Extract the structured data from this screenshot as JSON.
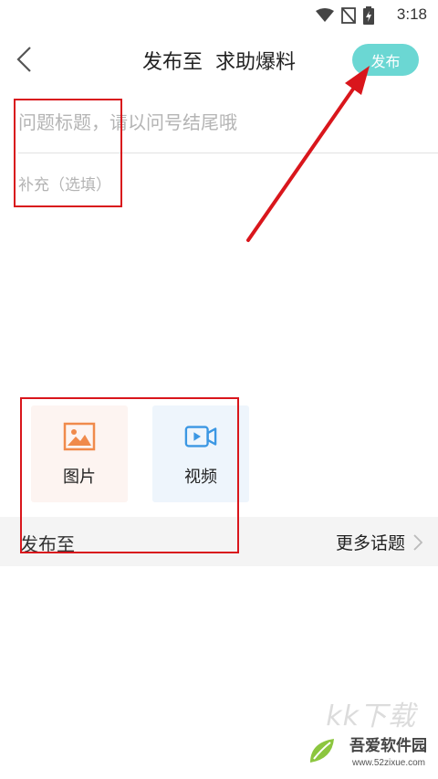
{
  "status_bar": {
    "time": "3:18"
  },
  "header": {
    "title": "发布至  求助爆料",
    "publish_label": "发布"
  },
  "form": {
    "title_placeholder": "问题标题，请以问号结尾哦",
    "supplement_placeholder": "补充（选填）"
  },
  "media": {
    "image_label": "图片",
    "video_label": "视频"
  },
  "publish_to": {
    "label": "发布至",
    "more_topics": "更多话题"
  },
  "watermark": {
    "logo": "kk下载",
    "site_name": "吾爱软件园",
    "url": "www.52zixue.com"
  },
  "colors": {
    "accent": "#6bd7d3",
    "annotation": "#d9161c",
    "image_icon": "#f08a4b",
    "video_icon": "#3b97e3"
  },
  "icons": [
    "wifi-icon",
    "no-sim-icon",
    "battery-icon",
    "back-icon",
    "image-icon",
    "video-icon",
    "chevron-right-icon"
  ]
}
